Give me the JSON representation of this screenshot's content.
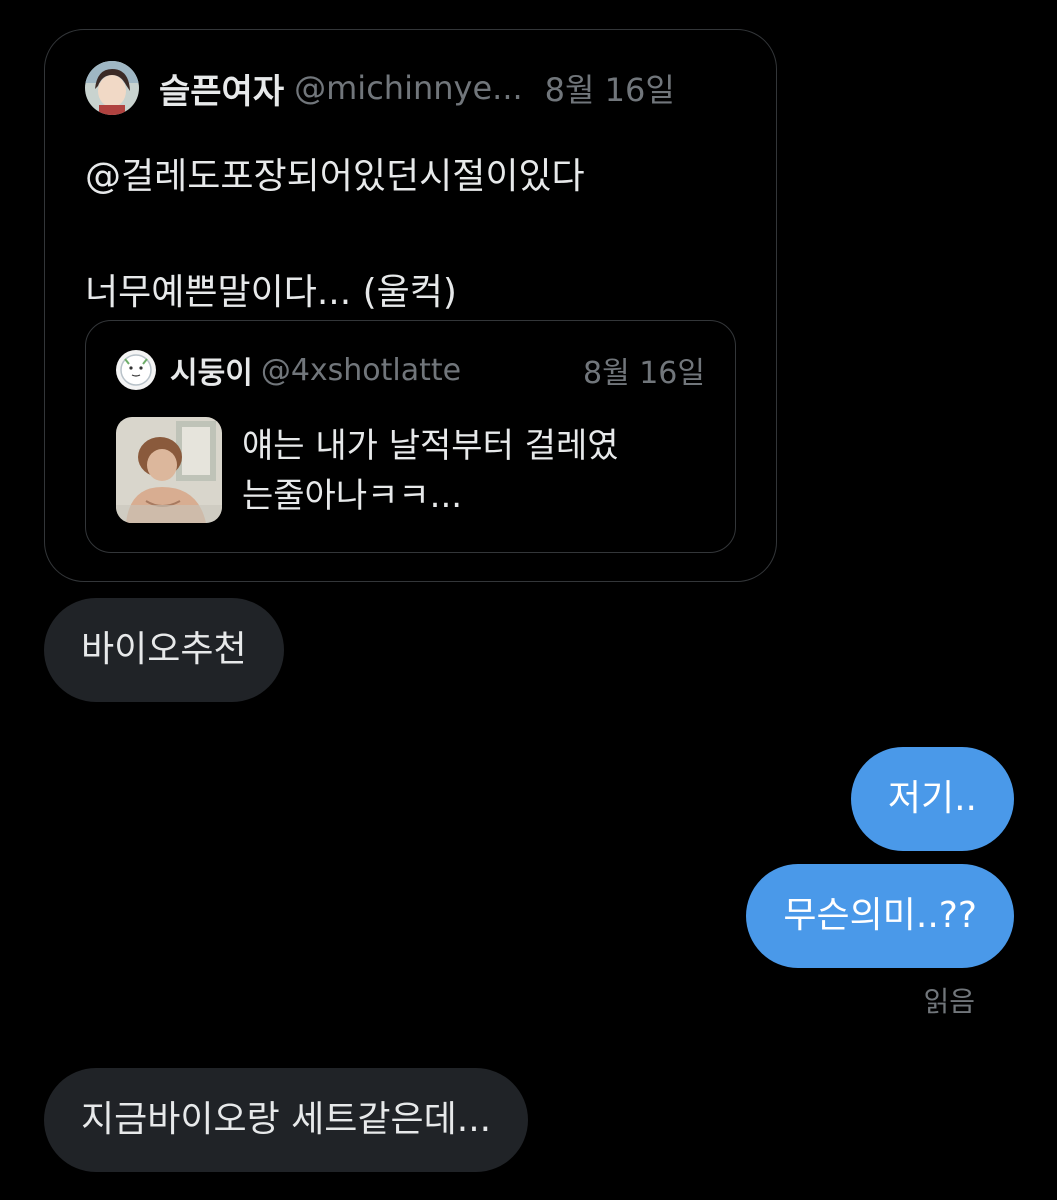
{
  "quote": {
    "author": {
      "name": "슬픈여자",
      "handle": "@michinnye...",
      "date": "8월 16일",
      "avatar_icon": "profile-avatar-anime-girl"
    },
    "text_lines": [
      "@걸레도포장되어있던시절이있다",
      "",
      "너무예쁜말이다... (울컥)"
    ],
    "nested": {
      "author": {
        "name": "시둥이",
        "handle": "@4xshotlatte",
        "date": "8월 16일",
        "avatar_icon": "profile-avatar-drawing"
      },
      "text_lines": [
        "얘는 내가 날적부터 걸레였",
        "는줄아나ㅋㅋ..."
      ],
      "thumbnail_icon": "comic-thumbnail-image"
    }
  },
  "messages": [
    {
      "direction": "received",
      "text": "바이오추천"
    },
    {
      "direction": "sent",
      "text": "저기.."
    },
    {
      "direction": "sent",
      "text": "무슨의미..??"
    },
    {
      "direction": "received",
      "text": "지금바이오랑 세트같은데..."
    }
  ],
  "read_receipt": "읽음",
  "colors": {
    "background": "#000000",
    "received_bubble": "#202327",
    "sent_bubble": "#4a99e9",
    "muted_text": "#71767b",
    "primary_text": "#e7e9ea",
    "card_border": "#333639"
  }
}
